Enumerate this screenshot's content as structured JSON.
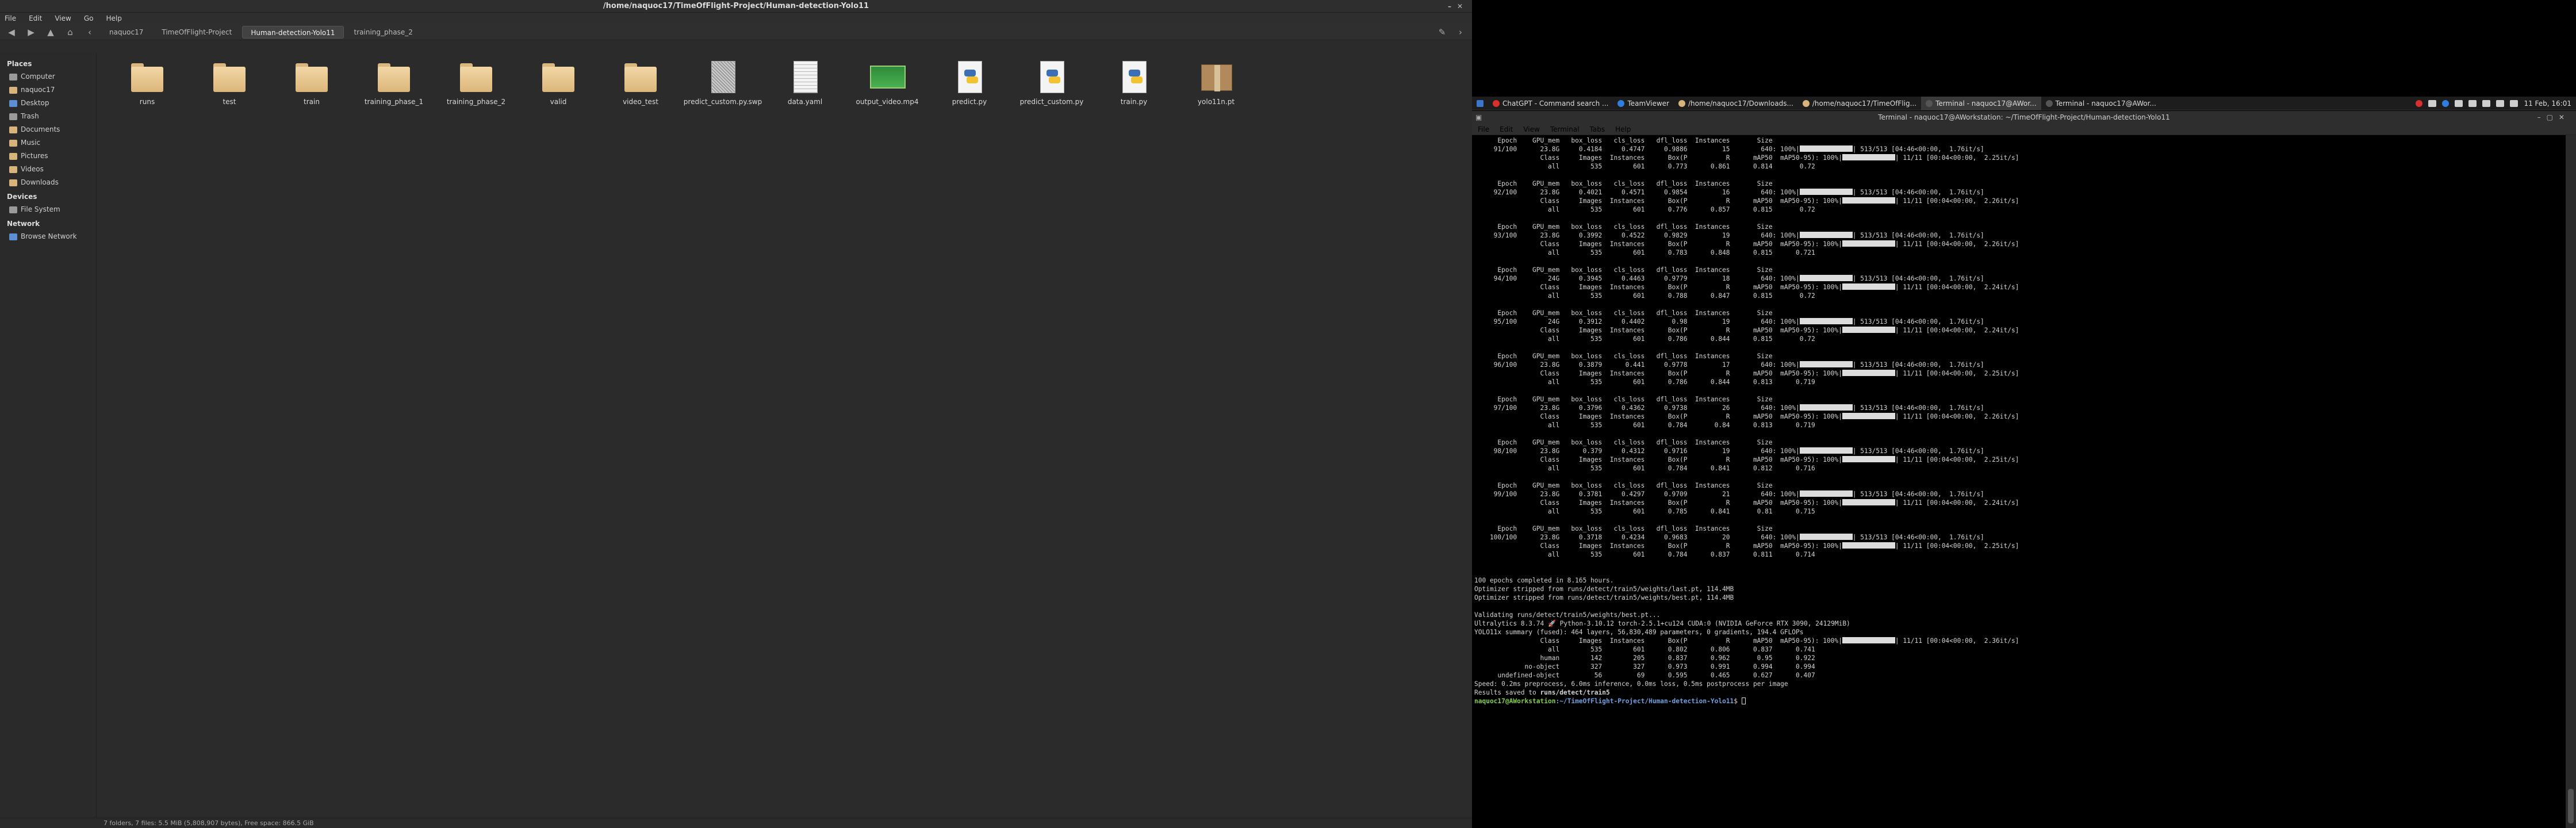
{
  "file_manager": {
    "title": "/home/naquoc17/TimeOfFlight-Project/Human-detection-Yolo11",
    "menu": [
      "File",
      "Edit",
      "View",
      "Go",
      "Help"
    ],
    "breadcrumbs": [
      "naquoc17",
      "TimeOfFlight-Project",
      "Human-detection-Yolo11",
      "training_phase_2"
    ],
    "active_crumb": 2,
    "sidebar": {
      "places_heading": "Places",
      "places": [
        "Computer",
        "naquoc17",
        "Desktop",
        "Trash",
        "Documents",
        "Music",
        "Pictures",
        "Videos",
        "Downloads"
      ],
      "devices_heading": "Devices",
      "devices": [
        "File System"
      ],
      "network_heading": "Network",
      "network": [
        "Browse Network"
      ]
    },
    "files": [
      {
        "name": "runs",
        "kind": "folder"
      },
      {
        "name": "test",
        "kind": "folder"
      },
      {
        "name": "train",
        "kind": "folder"
      },
      {
        "name": "training_phase_1",
        "kind": "folder"
      },
      {
        "name": "training_phase_2",
        "kind": "folder"
      },
      {
        "name": "valid",
        "kind": "folder"
      },
      {
        "name": "video_test",
        "kind": "folder"
      },
      {
        "name": "predict_custom.py.swp",
        "kind": "binary"
      },
      {
        "name": "data.yaml",
        "kind": "text"
      },
      {
        "name": "output_video.mp4",
        "kind": "video"
      },
      {
        "name": "predict.py",
        "kind": "python"
      },
      {
        "name": "predict_custom.py",
        "kind": "python"
      },
      {
        "name": "train.py",
        "kind": "python"
      },
      {
        "name": "yolo11n.pt",
        "kind": "package"
      }
    ],
    "status": "7 folders, 7 files: 5.5 MiB (5,808,907 bytes), Free space: 866.5 GiB"
  },
  "panel": {
    "items": [
      {
        "label": "ChatGPT - Command search ...",
        "color": "#d9302c"
      },
      {
        "label": "TeamViewer",
        "color": "#2f7de1"
      },
      {
        "label": "/home/naquoc17/Downloads...",
        "color": "#d8b37a"
      },
      {
        "label": "/home/naquoc17/TimeOfFlig...",
        "color": "#d8b37a"
      },
      {
        "label": "Terminal - naquoc17@AWor...",
        "color": "#555555",
        "active": true
      },
      {
        "label": "Terminal - naquoc17@AWor...",
        "color": "#555555"
      }
    ],
    "clock": "11 Feb, 16:01"
  },
  "terminal": {
    "title": "Terminal - naquoc17@AWorkstation: ~/TimeOfFlight-Project/Human-detection-Yolo11",
    "menu": [
      "File",
      "Edit",
      "View",
      "Terminal",
      "Tabs",
      "Help"
    ],
    "epoch_header": "      Epoch    GPU_mem   box_loss   cls_loss   dfl_loss  Instances       Size",
    "class_header": "                 Class     Images  Instances      Box(P          R      mAP50  mAP50-95): 100%|",
    "epochs": [
      {
        "epoch": "91/100",
        "gpu": "23.8G",
        "box": "0.4184",
        "cls": "0.4747",
        "dfl": "0.9886",
        "inst": "15",
        "it": "1.76it/s",
        "vt": "2.25it/s",
        "p": "0.773",
        "r": "0.861",
        "m50": "0.814",
        "m95": "0.72"
      },
      {
        "epoch": "92/100",
        "gpu": "23.8G",
        "box": "0.4021",
        "cls": "0.4571",
        "dfl": "0.9854",
        "inst": "16",
        "it": "1.76it/s",
        "vt": "2.26it/s",
        "p": "0.776",
        "r": "0.857",
        "m50": "0.815",
        "m95": "0.72"
      },
      {
        "epoch": "93/100",
        "gpu": "23.8G",
        "box": "0.3992",
        "cls": "0.4522",
        "dfl": "0.9829",
        "inst": "19",
        "it": "1.76it/s",
        "vt": "2.26it/s",
        "p": "0.783",
        "r": "0.848",
        "m50": "0.815",
        "m95": "0.721"
      },
      {
        "epoch": "94/100",
        "gpu": "24G",
        "box": "0.3945",
        "cls": "0.4463",
        "dfl": "0.9779",
        "inst": "18",
        "it": "1.76it/s",
        "vt": "2.24it/s",
        "p": "0.788",
        "r": "0.847",
        "m50": "0.815",
        "m95": "0.72"
      },
      {
        "epoch": "95/100",
        "gpu": "24G",
        "box": "0.3912",
        "cls": "0.4402",
        "dfl": "0.98",
        "inst": "19",
        "it": "1.76it/s",
        "vt": "2.24it/s",
        "p": "0.786",
        "r": "0.844",
        "m50": "0.815",
        "m95": "0.72"
      },
      {
        "epoch": "96/100",
        "gpu": "23.8G",
        "box": "0.3879",
        "cls": "0.441",
        "dfl": "0.9778",
        "inst": "17",
        "it": "1.76it/s",
        "vt": "2.25it/s",
        "p": "0.786",
        "r": "0.844",
        "m50": "0.813",
        "m95": "0.719"
      },
      {
        "epoch": "97/100",
        "gpu": "23.8G",
        "box": "0.3796",
        "cls": "0.4362",
        "dfl": "0.9738",
        "inst": "26",
        "it": "1.76it/s",
        "vt": "2.26it/s",
        "p": "0.784",
        "r": "0.84",
        "m50": "0.813",
        "m95": "0.719"
      },
      {
        "epoch": "98/100",
        "gpu": "23.8G",
        "box": "0.379",
        "cls": "0.4312",
        "dfl": "0.9716",
        "inst": "19",
        "it": "1.76it/s",
        "vt": "2.25it/s",
        "p": "0.784",
        "r": "0.841",
        "m50": "0.812",
        "m95": "0.716"
      },
      {
        "epoch": "99/100",
        "gpu": "23.8G",
        "box": "0.3781",
        "cls": "0.4297",
        "dfl": "0.9709",
        "inst": "21",
        "it": "1.76it/s",
        "vt": "2.24it/s",
        "p": "0.785",
        "r": "0.841",
        "m50": "0.81",
        "m95": "0.715"
      },
      {
        "epoch": "100/100",
        "gpu": "23.8G",
        "box": "0.3718",
        "cls": "0.4234",
        "dfl": "0.9683",
        "inst": "20",
        "it": "1.76it/s",
        "vt": "2.25it/s",
        "p": "0.784",
        "r": "0.837",
        "m50": "0.811",
        "m95": "0.714"
      }
    ],
    "train_bar_text": "513/513 [04:46<00:00,",
    "val_bar_text": "11/11 [00:04<00:00,",
    "all_row_prefix": "                   all        535        601",
    "summary_lines": [
      "",
      "100 epochs completed in 8.165 hours.",
      "Optimizer stripped from runs/detect/train5/weights/last.pt, 114.4MB",
      "Optimizer stripped from runs/detect/train5/weights/best.pt, 114.4MB",
      "",
      "Validating runs/detect/train5/weights/best.pt...",
      "Ultralytics 8.3.74 🚀 Python-3.10.12 torch-2.5.1+cu124 CUDA:0 (NVIDIA GeForce RTX 3090, 24129MiB)",
      "YOLO11x summary (fused): 464 layers, 56,830,489 parameters, 0 gradients, 194.4 GFLOPs"
    ],
    "final_val_line": "11/11 [00:04<00:00,  2.36it/s]",
    "final_rows": [
      "                   all        535        601      0.802      0.806      0.837      0.741",
      "                 human        142        205      0.837      0.962       0.95      0.922",
      "             no-object        327        327      0.973      0.991      0.994      0.994",
      "      undefined-object         56         69      0.595      0.465      0.627      0.407"
    ],
    "speed_line": "Speed: 0.2ms preprocess, 6.0ms inference, 0.0ms loss, 0.5ms postprocess per image",
    "results_prefix": "Results saved to ",
    "results_path": "runs/detect/train5",
    "prompt_user": "naquoc17@AWorkstation",
    "prompt_path": ":~/TimeOfFlight-Project/Human-detection-Yolo11",
    "prompt_suffix": "$ "
  }
}
